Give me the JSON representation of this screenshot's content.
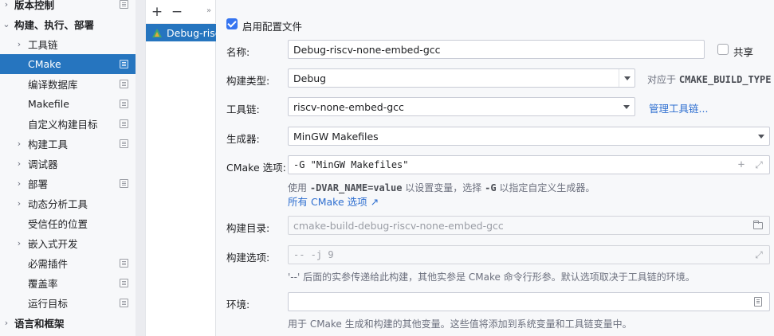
{
  "tree": {
    "items": [
      {
        "label": "版本控制",
        "chevron": "›",
        "bold": true,
        "proj": true
      },
      {
        "label": "构建、执行、部署",
        "chevron": "⌄",
        "bold": true,
        "proj": false
      },
      {
        "label": "工具链",
        "chevron": "›",
        "bold": false,
        "proj": false
      },
      {
        "label": "CMake",
        "chevron": "",
        "bold": false,
        "proj": true,
        "selected": true
      },
      {
        "label": "编译数据库",
        "chevron": "",
        "bold": false,
        "proj": true
      },
      {
        "label": "Makefile",
        "chevron": "",
        "bold": false,
        "proj": true
      },
      {
        "label": "自定义构建目标",
        "chevron": "",
        "bold": false,
        "proj": true
      },
      {
        "label": "构建工具",
        "chevron": "›",
        "bold": false,
        "proj": true
      },
      {
        "label": "调试器",
        "chevron": "›",
        "bold": false,
        "proj": false
      },
      {
        "label": "部署",
        "chevron": "›",
        "bold": false,
        "proj": true
      },
      {
        "label": "动态分析工具",
        "chevron": "›",
        "bold": false,
        "proj": false
      },
      {
        "label": "受信任的位置",
        "chevron": "",
        "bold": false,
        "proj": false
      },
      {
        "label": "嵌入式开发",
        "chevron": "›",
        "bold": false,
        "proj": false
      },
      {
        "label": "必需插件",
        "chevron": "",
        "bold": false,
        "proj": true
      },
      {
        "label": "覆盖率",
        "chevron": "",
        "bold": false,
        "proj": true
      },
      {
        "label": "运行目标",
        "chevron": "",
        "bold": false,
        "proj": true
      },
      {
        "label": "语言和框架",
        "chevron": "›",
        "bold": true,
        "proj": false
      }
    ]
  },
  "profiles": {
    "add_label": "+",
    "remove_label": "−",
    "more_label": "»",
    "selected_profile": "Debug-riscv-none-embed-gcc"
  },
  "form": {
    "enable_profile": {
      "label": "启用配置文件",
      "checked": true
    },
    "name": {
      "label": "名称:",
      "value": "Debug-riscv-none-embed-gcc"
    },
    "share": {
      "label": "共享",
      "checked": false
    },
    "build_type": {
      "label": "构建类型:",
      "value": "Debug",
      "note_prefix": "对应于",
      "note_code": "CMAKE_BUILD_TYPE"
    },
    "toolchain": {
      "label": "工具链:",
      "value": "riscv-none-embed-gcc",
      "manage_link": "管理工具链..."
    },
    "generator": {
      "label": "生成器:",
      "value": "MinGW Makefiles"
    },
    "cmake_options": {
      "label": "CMake 选项:",
      "value": "-G \"MinGW Makefiles\"",
      "hint_1": "使用",
      "hint_code_1": "-DVAR_NAME=value",
      "hint_2": "以设置变量，选择",
      "hint_code_2": "-G",
      "hint_3": "以指定自定义生成器。",
      "all_options_link": "所有 CMake 选项 ↗"
    },
    "build_dir": {
      "label": "构建目录:",
      "value": "cmake-build-debug-riscv-none-embed-gcc"
    },
    "build_options": {
      "label": "构建选项:",
      "value": "-- -j 9",
      "hint": "'--' 后面的实参传递给此构建，其他实参是 CMake 命令行形参。默认选项取决于工具链的环境。"
    },
    "environment": {
      "label": "环境:",
      "value": "",
      "hint": "用于 CMake 生成和构建的其他变量。这些值将添加到系统变量和工具链变量中。"
    }
  },
  "colors": {
    "selection": "#2675bf",
    "link": "#2f6fd0",
    "checkbox": "#3574f0"
  }
}
